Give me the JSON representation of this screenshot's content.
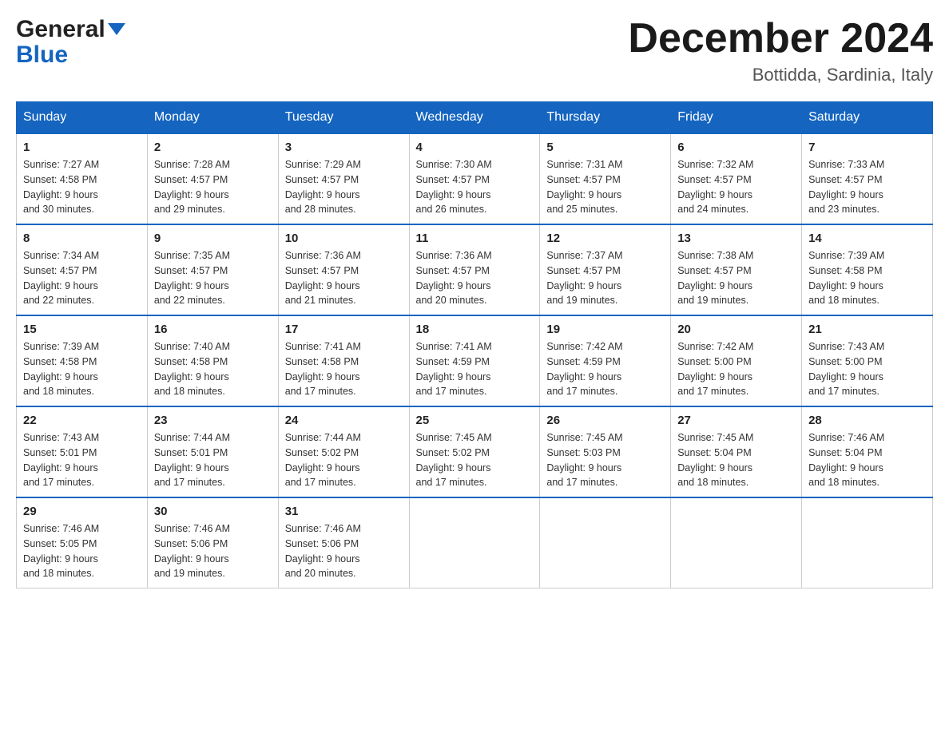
{
  "header": {
    "logo_line1": "General",
    "logo_line2": "Blue",
    "month_title": "December 2024",
    "location": "Bottidda, Sardinia, Italy"
  },
  "weekdays": [
    "Sunday",
    "Monday",
    "Tuesday",
    "Wednesday",
    "Thursday",
    "Friday",
    "Saturday"
  ],
  "weeks": [
    [
      {
        "day": "1",
        "sunrise": "7:27 AM",
        "sunset": "4:58 PM",
        "daylight": "9 hours and 30 minutes."
      },
      {
        "day": "2",
        "sunrise": "7:28 AM",
        "sunset": "4:57 PM",
        "daylight": "9 hours and 29 minutes."
      },
      {
        "day": "3",
        "sunrise": "7:29 AM",
        "sunset": "4:57 PM",
        "daylight": "9 hours and 28 minutes."
      },
      {
        "day": "4",
        "sunrise": "7:30 AM",
        "sunset": "4:57 PM",
        "daylight": "9 hours and 26 minutes."
      },
      {
        "day": "5",
        "sunrise": "7:31 AM",
        "sunset": "4:57 PM",
        "daylight": "9 hours and 25 minutes."
      },
      {
        "day": "6",
        "sunrise": "7:32 AM",
        "sunset": "4:57 PM",
        "daylight": "9 hours and 24 minutes."
      },
      {
        "day": "7",
        "sunrise": "7:33 AM",
        "sunset": "4:57 PM",
        "daylight": "9 hours and 23 minutes."
      }
    ],
    [
      {
        "day": "8",
        "sunrise": "7:34 AM",
        "sunset": "4:57 PM",
        "daylight": "9 hours and 22 minutes."
      },
      {
        "day": "9",
        "sunrise": "7:35 AM",
        "sunset": "4:57 PM",
        "daylight": "9 hours and 22 minutes."
      },
      {
        "day": "10",
        "sunrise": "7:36 AM",
        "sunset": "4:57 PM",
        "daylight": "9 hours and 21 minutes."
      },
      {
        "day": "11",
        "sunrise": "7:36 AM",
        "sunset": "4:57 PM",
        "daylight": "9 hours and 20 minutes."
      },
      {
        "day": "12",
        "sunrise": "7:37 AM",
        "sunset": "4:57 PM",
        "daylight": "9 hours and 19 minutes."
      },
      {
        "day": "13",
        "sunrise": "7:38 AM",
        "sunset": "4:57 PM",
        "daylight": "9 hours and 19 minutes."
      },
      {
        "day": "14",
        "sunrise": "7:39 AM",
        "sunset": "4:58 PM",
        "daylight": "9 hours and 18 minutes."
      }
    ],
    [
      {
        "day": "15",
        "sunrise": "7:39 AM",
        "sunset": "4:58 PM",
        "daylight": "9 hours and 18 minutes."
      },
      {
        "day": "16",
        "sunrise": "7:40 AM",
        "sunset": "4:58 PM",
        "daylight": "9 hours and 18 minutes."
      },
      {
        "day": "17",
        "sunrise": "7:41 AM",
        "sunset": "4:58 PM",
        "daylight": "9 hours and 17 minutes."
      },
      {
        "day": "18",
        "sunrise": "7:41 AM",
        "sunset": "4:59 PM",
        "daylight": "9 hours and 17 minutes."
      },
      {
        "day": "19",
        "sunrise": "7:42 AM",
        "sunset": "4:59 PM",
        "daylight": "9 hours and 17 minutes."
      },
      {
        "day": "20",
        "sunrise": "7:42 AM",
        "sunset": "5:00 PM",
        "daylight": "9 hours and 17 minutes."
      },
      {
        "day": "21",
        "sunrise": "7:43 AM",
        "sunset": "5:00 PM",
        "daylight": "9 hours and 17 minutes."
      }
    ],
    [
      {
        "day": "22",
        "sunrise": "7:43 AM",
        "sunset": "5:01 PM",
        "daylight": "9 hours and 17 minutes."
      },
      {
        "day": "23",
        "sunrise": "7:44 AM",
        "sunset": "5:01 PM",
        "daylight": "9 hours and 17 minutes."
      },
      {
        "day": "24",
        "sunrise": "7:44 AM",
        "sunset": "5:02 PM",
        "daylight": "9 hours and 17 minutes."
      },
      {
        "day": "25",
        "sunrise": "7:45 AM",
        "sunset": "5:02 PM",
        "daylight": "9 hours and 17 minutes."
      },
      {
        "day": "26",
        "sunrise": "7:45 AM",
        "sunset": "5:03 PM",
        "daylight": "9 hours and 17 minutes."
      },
      {
        "day": "27",
        "sunrise": "7:45 AM",
        "sunset": "5:04 PM",
        "daylight": "9 hours and 18 minutes."
      },
      {
        "day": "28",
        "sunrise": "7:46 AM",
        "sunset": "5:04 PM",
        "daylight": "9 hours and 18 minutes."
      }
    ],
    [
      {
        "day": "29",
        "sunrise": "7:46 AM",
        "sunset": "5:05 PM",
        "daylight": "9 hours and 18 minutes."
      },
      {
        "day": "30",
        "sunrise": "7:46 AM",
        "sunset": "5:06 PM",
        "daylight": "9 hours and 19 minutes."
      },
      {
        "day": "31",
        "sunrise": "7:46 AM",
        "sunset": "5:06 PM",
        "daylight": "9 hours and 20 minutes."
      },
      null,
      null,
      null,
      null
    ]
  ],
  "labels": {
    "sunrise": "Sunrise:",
    "sunset": "Sunset:",
    "daylight": "Daylight:"
  },
  "colors": {
    "header_bg": "#1565c0",
    "border_top": "#1565c0"
  }
}
